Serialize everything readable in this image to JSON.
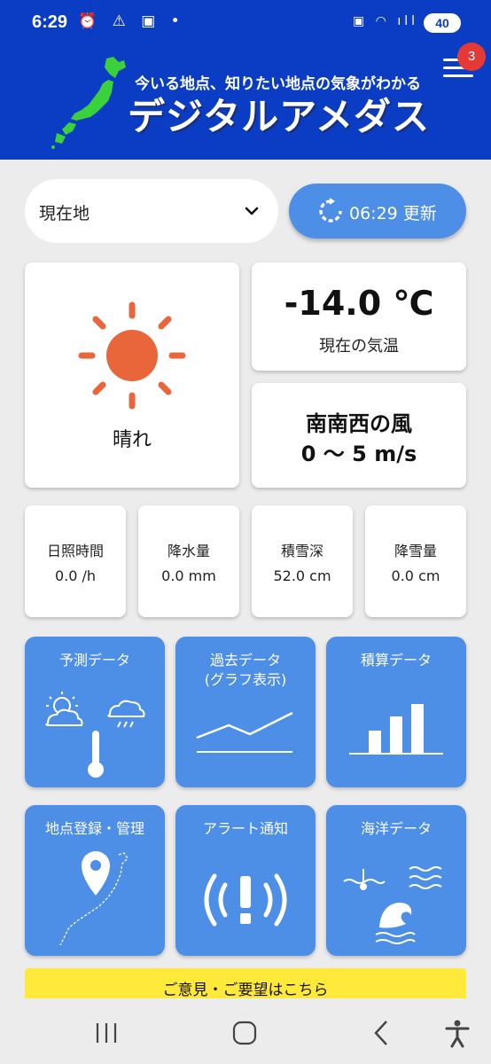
{
  "status_bar": {
    "time": "6:29",
    "left_icons": "⏰ ⚠ ▣ •",
    "right_icons": "▣ ◠ ıll",
    "battery": "40"
  },
  "header": {
    "subtitle": "今いる地点、知りたい地点の気象がわかる",
    "title": "デジタルアメダス",
    "menu_badge": "3"
  },
  "location": {
    "selected": "現在地"
  },
  "update_button": {
    "label": "06:29 更新"
  },
  "current": {
    "condition": "晴れ",
    "temperature": "-14.0 ℃",
    "temperature_label": "現在の気温",
    "wind_direction": "南南西の風",
    "wind_speed": "0 ～ 5 m/s"
  },
  "stats": [
    {
      "label": "日照時間",
      "value": "0.0 /h"
    },
    {
      "label": "降水量",
      "value": "0.0 mm"
    },
    {
      "label": "積雪深",
      "value": "52.0 cm"
    },
    {
      "label": "降雪量",
      "value": "0.0 cm"
    }
  ],
  "tiles": [
    {
      "title": "予測データ",
      "icon": "forecast-icon"
    },
    {
      "title": "過去データ\n(グラフ表示)",
      "title_line1": "過去データ",
      "title_line2": "(グラフ表示)",
      "icon": "line-graph-icon"
    },
    {
      "title": "積算データ",
      "icon": "bar-graph-icon"
    },
    {
      "title": "地点登録・管理",
      "icon": "map-pin-icon"
    },
    {
      "title": "アラート通知",
      "icon": "alert-icon"
    },
    {
      "title": "海洋データ",
      "icon": "ocean-icon"
    }
  ],
  "feedback": {
    "label": "ご意見・ご要望はこちら"
  },
  "colors": {
    "header": "#0b3cc4",
    "accent": "#4d8ee6",
    "sun": "#e8663a",
    "badge": "#e53935",
    "feedback": "#ffe93b"
  }
}
